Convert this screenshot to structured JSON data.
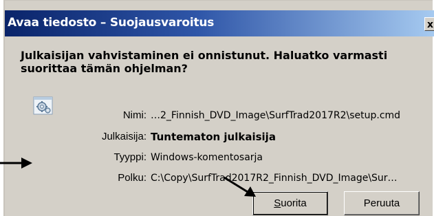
{
  "dialog": {
    "title": "Avaa tiedosto – Suojausvaroitus",
    "close_glyph": "x",
    "message_line1": "Julkaisijan vahvistaminen ei onnistunut. Haluatko varmasti",
    "message_line2": "suorittaa tämän ohjelman?",
    "icon": "gear-application-icon",
    "fields": {
      "name_label": "Nimi:",
      "name_value": "…2_Finnish_DVD_Image\\SurfTrad2017R2\\setup.cmd",
      "publisher_label": "Julkaisija:",
      "publisher_value": "Tuntematon julkaisija",
      "type_label": "Tyyppi:",
      "type_value": "Windows-komentosarja",
      "path_label": "Polku:",
      "path_value": "C:\\Copy\\SurfTrad2017R2_Finnish_DVD_Image\\Sur…"
    },
    "buttons": {
      "run_accel": "S",
      "run_rest": "uorita",
      "cancel": "Peruuta"
    }
  },
  "annotations": {
    "arrow_color": "#000000"
  },
  "colors": {
    "title_start": "#0a246a",
    "title_end": "#a6caf0",
    "dialog_bg": "#d4d0c8"
  }
}
